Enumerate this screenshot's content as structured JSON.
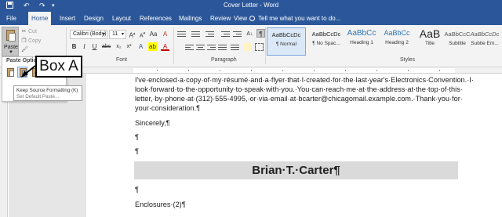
{
  "window": {
    "title": "Cover Letter - Word",
    "quick_access": {
      "save_icon": "save-icon",
      "undo_icon": "undo-icon",
      "redo_icon": "redo-icon"
    }
  },
  "tabs": [
    "File",
    "Home",
    "Insert",
    "Design",
    "Layout",
    "References",
    "Mailings",
    "Review",
    "View"
  ],
  "active_tab": "Home",
  "tell_me": "Tell me what you want to do...",
  "clipboard": {
    "paste_label": "Paste",
    "cut_label": "Cut",
    "copy_label": "Copy",
    "format_painter_icon": "format-painter-icon"
  },
  "font": {
    "name": "Calibri (Body)",
    "size": "11",
    "group_label": "Font"
  },
  "paragraph": {
    "group_label": "Paragraph"
  },
  "styles": {
    "group_label": "Styles",
    "items": [
      {
        "sample": "AaBbCcDc",
        "name": "¶ Normal"
      },
      {
        "sample": "AaBbCcDc",
        "name": "¶ No Spac..."
      },
      {
        "sample": "AaBbCc",
        "name": "Heading 1"
      },
      {
        "sample": "AaBbCc",
        "name": "Heading 2"
      },
      {
        "sample": "AaB",
        "name": "Title"
      },
      {
        "sample": "AaBbCcC",
        "name": "Subtitle"
      },
      {
        "sample": "AaBbCcDc",
        "name": "Subtle Em..."
      }
    ]
  },
  "paste_options": {
    "header": "Paste Options:",
    "tooltip_line1": "Keep Source Formatting (K)",
    "tooltip_line2": "Set Default Paste..."
  },
  "annotation": {
    "label": "Box A"
  },
  "document": {
    "paragraph_lines": [
      "I've·enclosed·a·copy·of·my·résumé·and·a·flyer·that·I·created·for·the·last·year's·Electronics·Convention.·I·",
      "look·forward·to·the·opportunity·to·speak·with·you.·You·can·reach·me·at·the·address·at·the·top·of·this·",
      "letter,·by·phone·at·(312)·555-4995,·or·via·email·at·bcarter@chicagomail.example.com.·Thank·you·for·",
      "your·consideration.¶"
    ],
    "closing": "Sincerely,¶",
    "blank_1": "¶",
    "blank_2": "¶",
    "name": "Brian·T.·Carter¶",
    "blank_3": "¶",
    "enclosures": "Enclosures·(2)¶"
  },
  "colors": {
    "title_bar": "#2b579a",
    "ribbon": "#f3f3f3",
    "name_band": "#dadada"
  }
}
